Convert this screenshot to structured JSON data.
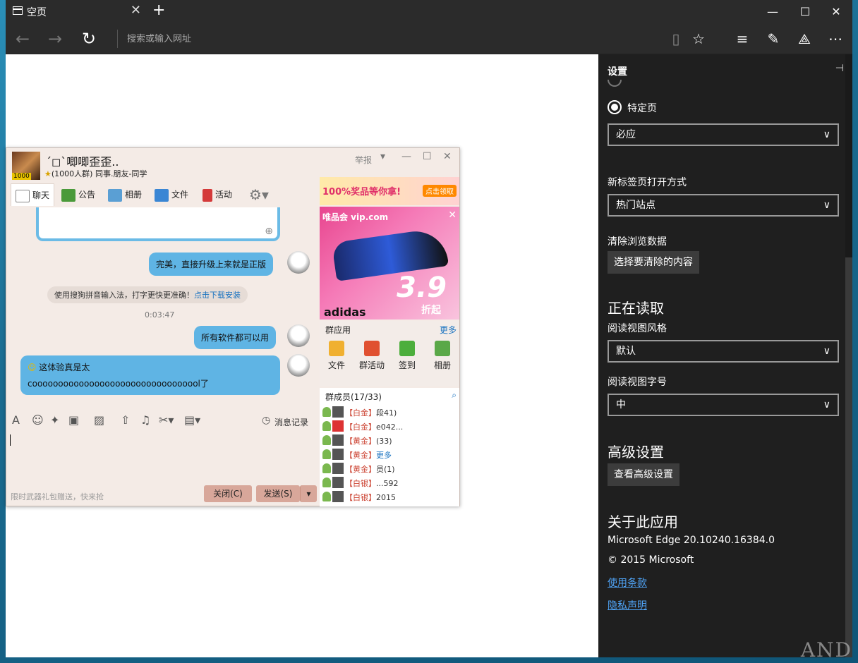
{
  "browser": {
    "tab_title": "空页",
    "address_placeholder": "搜索或输入网址"
  },
  "qq": {
    "group_name": "ˊ◻ˋ唧唧歪歪..",
    "group_info": "(1000人群) 同事.朋友-同学",
    "avatar_badge": "1000",
    "report": "举报",
    "tabs": [
      "聊天",
      "公告",
      "相册",
      "文件",
      "活动"
    ],
    "messages": {
      "m1": "完美，直接升级上来就是正版",
      "system": "使用搜狗拼音输入法，打字更快更准确！",
      "system_link": "点击下载安装",
      "time": "0:03:47",
      "m2": "所有软件都可以用",
      "m3_line1": "这体验真是太",
      "m3_line2": "cooooooooooooooooooooooooooooooool了"
    },
    "history": "消息记录",
    "footer_ad": "限时武器礼包赠送，快来抢",
    "close_btn": "关闭(C)",
    "send_btn": "发送(S)",
    "banner_text": "100%奖品等你拿!",
    "banner_btn": "点击领取",
    "ad_logo": "唯品会 vip.com",
    "ad_price": "3.9",
    "ad_discount": "折起",
    "ad_brand": "adidas",
    "apps_title": "群应用",
    "apps_more": "更多",
    "apps": [
      "文件",
      "群活动",
      "签到",
      "相册"
    ],
    "members_title": "群成员(17/33)",
    "members": [
      {
        "level": "【白金】",
        "name": "段41)"
      },
      {
        "level": "【白金】",
        "name": "e042..."
      },
      {
        "level": "【黄金】",
        "name": "(33)"
      },
      {
        "level": "【黄金】",
        "name": "更多"
      },
      {
        "level": "【黄金】",
        "name": "员(1)"
      },
      {
        "level": "【白银】",
        "name": "...592"
      },
      {
        "level": "【白银】",
        "name": "2015"
      }
    ]
  },
  "settings": {
    "title": "设置",
    "radio_label": "特定页",
    "startpage_select": "必应",
    "newtab_label": "新标签页打开方式",
    "newtab_select": "热门站点",
    "clear_label": "清除浏览数据",
    "clear_button": "选择要清除的内容",
    "reading_heading": "正在读取",
    "style_label": "阅读视图风格",
    "style_select": "默认",
    "fontsize_label": "阅读视图字号",
    "fontsize_select": "中",
    "advanced_heading": "高级设置",
    "advanced_button": "查看高级设置",
    "about_heading": "关于此应用",
    "version": "Microsoft Edge 20.10240.16384.0",
    "copyright": "© 2015 Microsoft",
    "terms_link": "使用条款",
    "privacy_link": "隐私声明"
  },
  "watermark": "AND",
  "colors": {
    "settings_bg": "#1f1f1f",
    "link": "#4fa3f5",
    "bubble": "#5fb4e4"
  }
}
